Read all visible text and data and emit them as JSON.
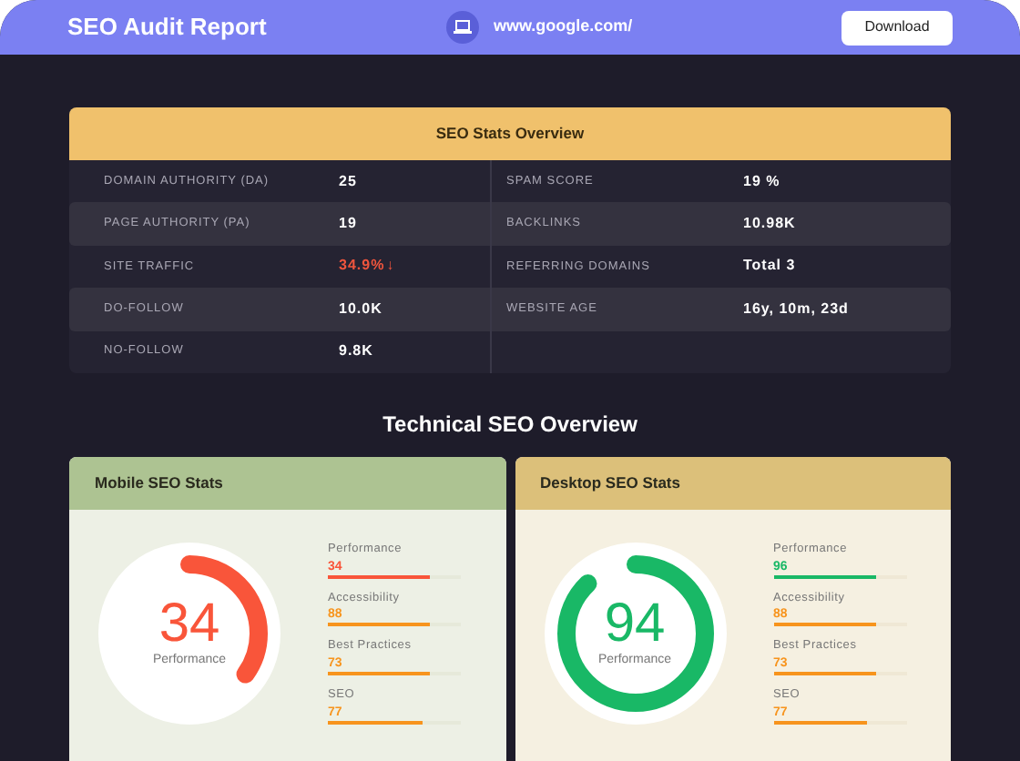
{
  "header": {
    "title": "SEO Audit Report",
    "url": "www.google.com/",
    "download": "Download"
  },
  "stats": {
    "title": "SEO Stats Overview",
    "rows": [
      {
        "label": "DOMAIN AUTHORITY (DA)",
        "value": "25",
        "label2": "SPAM SCORE",
        "value2": "19 %"
      },
      {
        "label": "PAGE AUTHORITY (PA)",
        "value": "19",
        "label2": "BACKLINKS",
        "value2": "10.98K"
      },
      {
        "label": "SITE TRAFFIC",
        "value": "34.9%",
        "trend": "↓",
        "label2": "REFERRING DOMAINS",
        "value2": "Total 3"
      },
      {
        "label": "DO-FOLLOW",
        "value": "10.0K",
        "label2": "WEBSITE AGE",
        "value2": "16y, 10m, 23d"
      },
      {
        "label": "NO-FOLLOW",
        "value": "9.8K"
      }
    ]
  },
  "section_title": "Technical SEO Overview",
  "cards": [
    {
      "title": "Mobile SEO Stats",
      "color": "#adc392",
      "gauge": {
        "value": "34",
        "label": "Performance",
        "color": "#f9553a"
      },
      "metrics": [
        {
          "name": "Performance",
          "value": "34",
          "color": "#f9553a",
          "level": 0.77
        },
        {
          "name": "Accessibility",
          "value": "88",
          "color": "#f7941d",
          "level": 0.77
        },
        {
          "name": "Best Practices",
          "value": "73",
          "color": "#f7941d",
          "level": 0.77
        },
        {
          "name": "SEO",
          "value": "77",
          "color": "#f7941d",
          "level": 0.71
        }
      ]
    },
    {
      "title": "Desktop SEO Stats",
      "color": "#dcc07a",
      "gauge": {
        "value": "94",
        "label": "Performance",
        "color": "#19b866"
      },
      "metrics": [
        {
          "name": "Performance",
          "value": "96",
          "color": "#19b866",
          "level": 0.77
        },
        {
          "name": "Accessibility",
          "value": "88",
          "color": "#f7941d",
          "level": 0.77
        },
        {
          "name": "Best Practices",
          "value": "73",
          "color": "#f7941d",
          "level": 0.77
        },
        {
          "name": "SEO",
          "value": "77",
          "color": "#f7941d",
          "level": 0.71
        }
      ]
    }
  ]
}
